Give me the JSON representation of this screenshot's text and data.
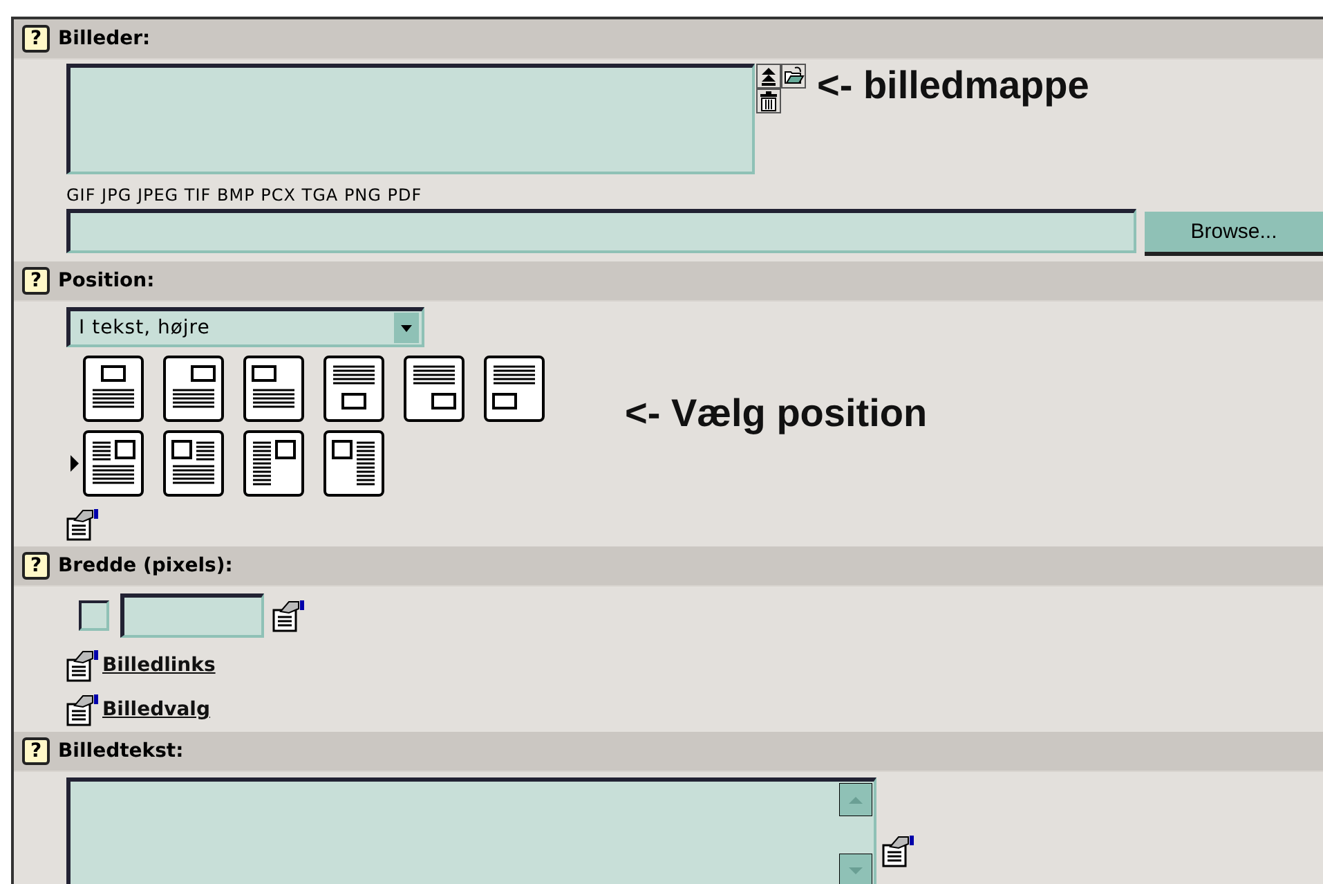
{
  "images": {
    "help": "?",
    "label": "Billeder:",
    "annotation": "<- billedmappe",
    "formats": "GIF JPG JPEG TIF BMP PCX TGA PNG PDF",
    "browse": "Browse..."
  },
  "position": {
    "help": "?",
    "label": "Position:",
    "select_value": "I tekst, højre",
    "annotation": "<- Vælg position",
    "layouts": [
      {
        "kind": "top-center",
        "selected": false
      },
      {
        "kind": "top-right",
        "selected": false
      },
      {
        "kind": "top-left",
        "selected": false
      },
      {
        "kind": "bottom-center",
        "selected": false
      },
      {
        "kind": "bottom-right",
        "selected": false
      },
      {
        "kind": "bottom-left",
        "selected": false
      },
      {
        "kind": "wrap-right",
        "selected": true
      },
      {
        "kind": "wrap-left",
        "selected": false
      },
      {
        "kind": "column-right",
        "selected": false
      },
      {
        "kind": "column-left",
        "selected": false
      }
    ]
  },
  "width": {
    "help": "?",
    "label": "Bredde (pixels):",
    "checked": false
  },
  "links": [
    "Billedlinks",
    "Billedvalg"
  ],
  "caption": {
    "help": "?",
    "label": "Billedtekst:"
  }
}
